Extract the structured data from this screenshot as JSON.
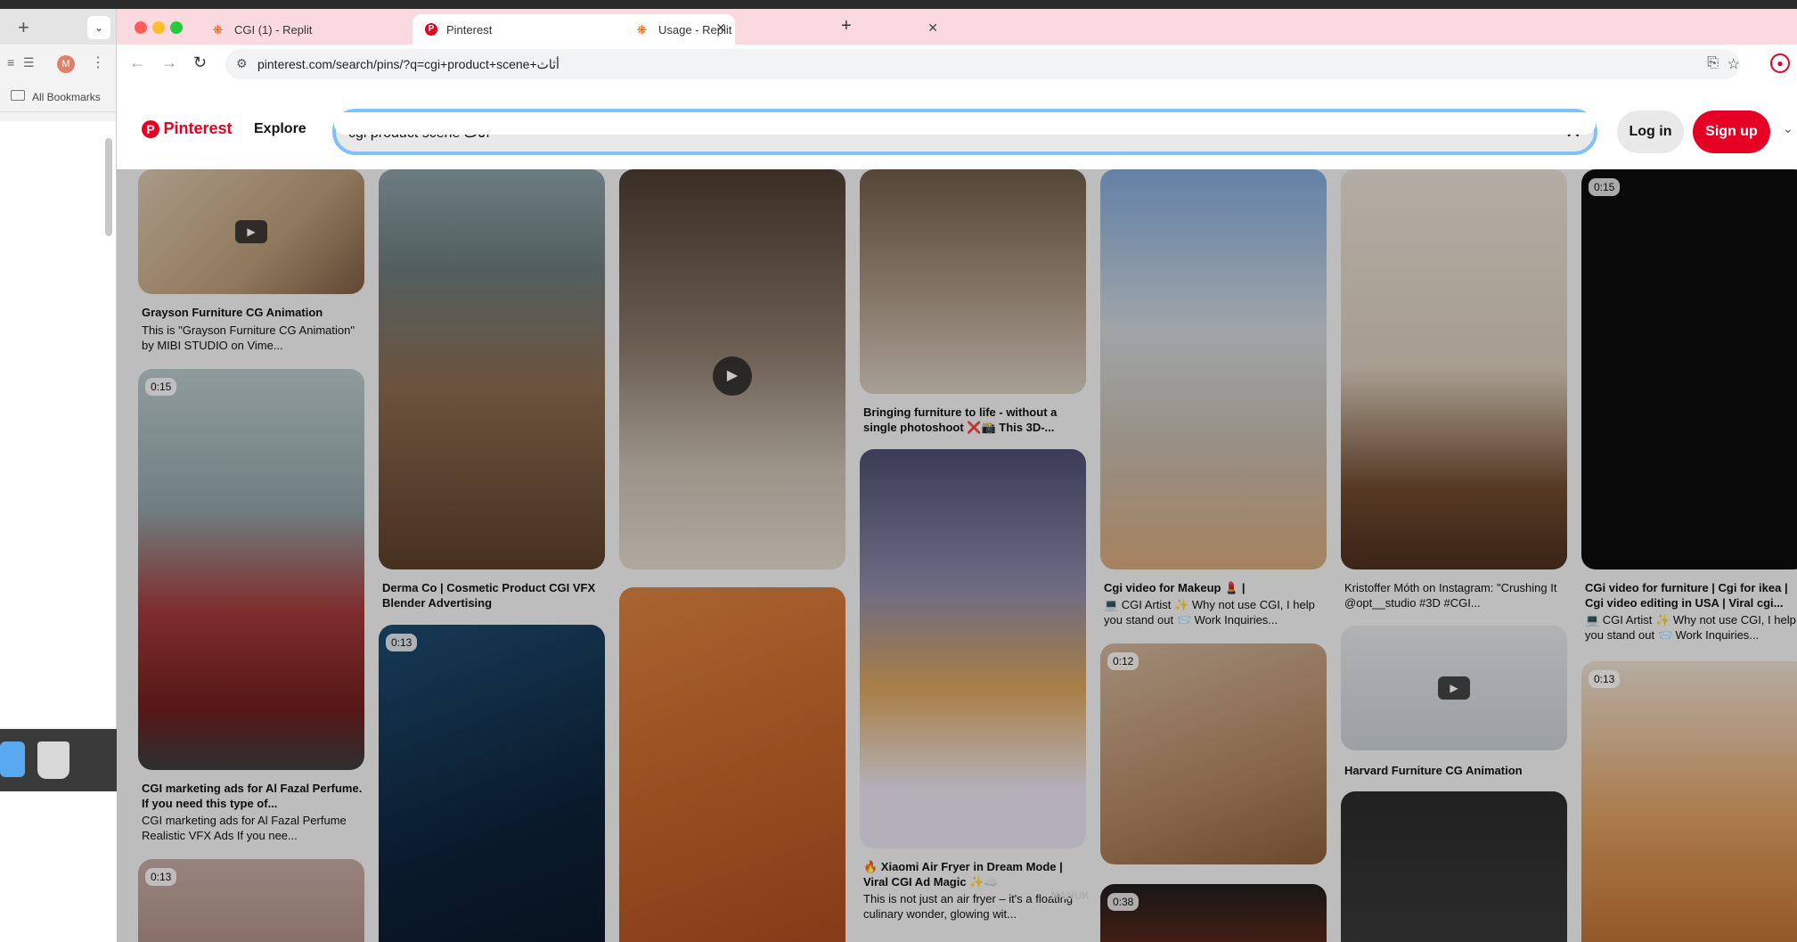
{
  "background_window": {
    "bookmarks_label": "All Bookmarks",
    "avatar_letter": "M",
    "dropdown_glyph": "⌄"
  },
  "tabs": [
    {
      "label": "CGI (1) - Replit",
      "icon": "replit-icon"
    },
    {
      "label": "Pinterest",
      "icon": "pinterest-icon",
      "active": true
    },
    {
      "label": "Usage - Replit",
      "icon": "replit-icon"
    }
  ],
  "address_bar": {
    "url": "pinterest.com/search/pins/?q=cgi+product+scene+أثاث"
  },
  "pinterest": {
    "logo_text": "Pinterest",
    "explore_label": "Explore",
    "search_value": "cgi product scene أثاث",
    "login_label": "Log in",
    "signup_label": "Sign up",
    "brand_color": "#e60023"
  },
  "pins": [
    {
      "duration": "",
      "title": "Grayson Furniture CG Animation",
      "desc": "This is \"Grayson Furniture CG Animation\" by MIBI STUDIO on Vime..."
    },
    {
      "duration": "0:15",
      "title": "CGI marketing ads for Al Fazal Perfume. If you need this type of...",
      "desc": "CGI marketing ads for Al Fazal Perfume Realistic VFX Ads If you nee..."
    },
    {
      "duration": "0:13",
      "title": "",
      "desc": ""
    },
    {
      "duration": "",
      "title": "Derma Co | Cosmetic Product CGI VFX Blender Advertising",
      "desc": ""
    },
    {
      "duration": "0:13",
      "title": "",
      "desc": ""
    },
    {
      "duration": "",
      "title": "",
      "desc": ""
    },
    {
      "duration": "",
      "title": "",
      "desc": ""
    },
    {
      "duration": "",
      "title": "Bringing furniture to life - without a single photoshoot ❌📸 This 3D-...",
      "desc": ""
    },
    {
      "duration": "",
      "title": "🔥 Xiaomi Air Fryer in Dream Mode | Viral CGI Ad Magic ✨☁️",
      "desc": "This is not just an air fryer – it's a floating culinary wonder, glowing wit..."
    },
    {
      "duration": "",
      "title": "Cgi video for Makeup 💄 |",
      "desc": "💻 CGI Artist ✨ Why not use CGI, I help you stand out 📨 Work Inquiries..."
    },
    {
      "duration": "0:12",
      "title": "",
      "desc": ""
    },
    {
      "duration": "0:38",
      "title": "",
      "desc": "",
      "brand": "NANUK"
    },
    {
      "duration": "",
      "title": "",
      "desc": "Kristoffer Móth on Instagram: \"Crushing It @opt__studio #3D #CGI..."
    },
    {
      "duration": "",
      "title": "Harvard Furniture CG Animation",
      "desc": ""
    },
    {
      "duration": "",
      "title": "",
      "desc": ""
    },
    {
      "duration": "0:15",
      "title": "CGi video for furniture | Cgi for ikea | Cgi video editing in USA | Viral cgi...",
      "desc": "💻 CGI Artist ✨ Why not use CGI, I help you stand out 📨 Work Inquiries..."
    },
    {
      "duration": "0:13",
      "title": "",
      "desc": ""
    }
  ]
}
